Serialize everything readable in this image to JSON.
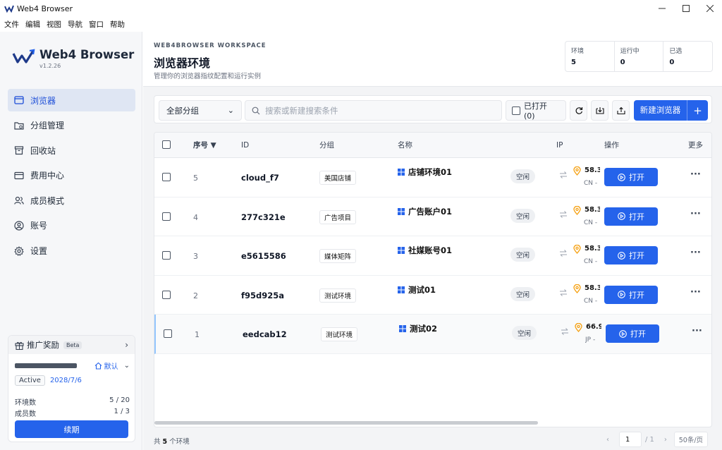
{
  "window": {
    "title": "Web4 Browser"
  },
  "menu": [
    "文件",
    "编辑",
    "视图",
    "导航",
    "窗口",
    "帮助"
  ],
  "brand": {
    "name": "Web4 Browser",
    "version": "v1.2.26"
  },
  "nav": [
    {
      "label": "浏览器",
      "icon": "browser-icon",
      "active": true
    },
    {
      "label": "分组管理",
      "icon": "folder-icon"
    },
    {
      "label": "回收站",
      "icon": "trash-icon"
    },
    {
      "label": "费用中心",
      "icon": "wallet-icon"
    },
    {
      "label": "成员模式",
      "icon": "users-icon"
    },
    {
      "label": "账号",
      "icon": "user-circle-icon"
    },
    {
      "label": "设置",
      "icon": "gear-icon"
    }
  ],
  "promo": {
    "title": "推广奖励",
    "badge": "Beta",
    "workspace_label": "默认",
    "status": "Active",
    "expiry": "2028/7/6",
    "env_count_label": "环境数",
    "env_count_value": "5 / 20",
    "member_count_label": "成员数",
    "member_count_value": "1 / 3",
    "renew_label": "续期"
  },
  "header": {
    "workspace_label": "WEB4BROWSER WORKSPACE",
    "title": "浏览器环境",
    "subtitle": "管理你的浏览器指纹配置和运行实例",
    "stats": [
      {
        "label": "环境",
        "value": "5"
      },
      {
        "label": "运行中",
        "value": "0"
      },
      {
        "label": "已选",
        "value": "0"
      }
    ]
  },
  "toolbar": {
    "group_select": "全部分组",
    "search_placeholder": "搜索或新建搜索条件",
    "opened_filter": "已打开 (0)",
    "new_button": "新建浏览器"
  },
  "table": {
    "columns": {
      "seq": "序号 ▼",
      "id": "ID",
      "group": "分组",
      "name": "名称",
      "ip": "IP",
      "actions": "操作",
      "more": "更多"
    },
    "open_label": "打开",
    "rows": [
      {
        "seq": "5",
        "id": "cloud_f7",
        "group": "美国店铺",
        "name": "店铺环境01",
        "status": "空闲",
        "ip": "58.3",
        "region": "CN -"
      },
      {
        "seq": "4",
        "id": "277c321e",
        "group": "广告项目",
        "name": "广告账户01",
        "status": "空闲",
        "ip": "58.3",
        "region": "CN -"
      },
      {
        "seq": "3",
        "id": "e5615586",
        "group": "媒体矩阵",
        "name": "社媒账号01",
        "status": "空闲",
        "ip": "58.3",
        "region": "CN -"
      },
      {
        "seq": "2",
        "id": "f95d925a",
        "group": "测试环境",
        "name": "测试01",
        "status": "空闲",
        "ip": "58.3",
        "region": "CN -"
      },
      {
        "seq": "1",
        "id": "eedcab12",
        "group": "测试环境",
        "name": "测试02",
        "status": "空闲",
        "ip": "66.9",
        "region": "JP -"
      }
    ]
  },
  "footer": {
    "total_prefix": "共",
    "total_count": "5",
    "total_suffix": "个环境",
    "page": "1",
    "page_total": "/ 1",
    "page_size": "50条/页"
  },
  "colors": {
    "accent": "#2563eb",
    "pin": "#f59e0b",
    "windows": "#2563eb"
  }
}
